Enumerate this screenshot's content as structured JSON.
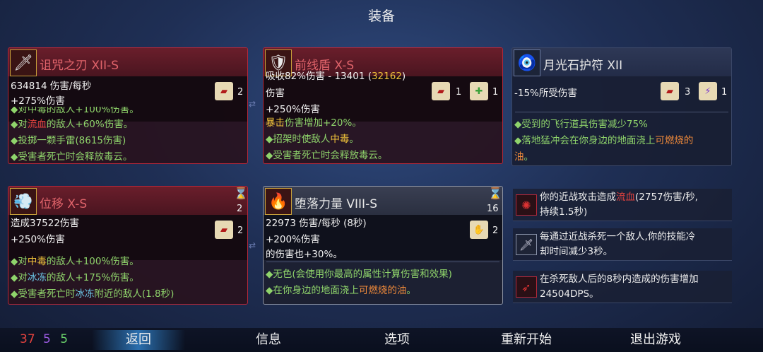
{
  "title": "装备",
  "cards": {
    "curse": {
      "name": "诅咒之刃  XII-S",
      "stat1": "634814 伤害/每秒",
      "stat2": "+275%伤害",
      "scroll_count": "2",
      "lines": [
        "◆对中毒的敌人+100%伤害。",
        "◆对流血的敌人+60%伤害。",
        "◆投掷一颗手雷(8615伤害)",
        "◆受害者死亡时会释放毒云。"
      ]
    },
    "shield": {
      "name": "前线盾  X-S",
      "stat1a": "吸收82%伤害 - 13401 (",
      "stat1b": "32162",
      "stat1c": ")",
      "stat2": "伤害",
      "stat3": "+250%伤害",
      "scroll1_count": "1",
      "scroll2_count": "1",
      "lines": [
        "◆暴击伤害增加+20%。",
        "◆招架时使敌人中毒。",
        "◆受害者死亡时会释放毒云。"
      ]
    },
    "amulet": {
      "name": "月光石护符  XII",
      "stat1": "-15%所受伤害",
      "scroll1_count": "3",
      "scroll2_count": "1",
      "lines": [
        "◆受到的飞行道具伤害减少75%",
        "◆落地猛冲会在你身边的地面浇上可燃烧的",
        "油。"
      ]
    },
    "dash": {
      "name": "位移  X-S",
      "stat1": "造成37522伤害",
      "stat2": "+250%伤害",
      "timer": "2",
      "scroll_count": "2",
      "lines": [
        "◆对中毒的敌人+100%伤害。",
        "◆对冰冻的敌人+175%伤害。",
        "◆受害者死亡时冰冻附近的敌人(1.8秒)"
      ]
    },
    "fall": {
      "name": "堕落力量  VIII-S",
      "stat1": "22973 伤害/每秒 (8秒)",
      "stat2": "+200%伤害",
      "stat3": "的伤害也+30%。",
      "timer": "16",
      "scroll_count": "2",
      "lines": [
        "◆无色(会使用你最高的属性计算伤害和效果)",
        "◆在你身边的地面浇上可燃烧的油。"
      ]
    }
  },
  "perks": [
    {
      "line1": "你的近战攻击造成流血(2757伤害/秒,",
      "line2": "持续1.5秒)"
    },
    {
      "line1": "每通过近战杀死一个敌人,你的技能冷",
      "line2": "却时间减少3秒。"
    },
    {
      "line1": "在杀死敌人后的8秒内造成的伤害增加",
      "line2": "24504DPS。"
    }
  ],
  "footer": {
    "stat_red": "37",
    "stat_purple": "5",
    "stat_green": "5",
    "back": "返回",
    "info": "信息",
    "options": "选项",
    "restart": "重新开始",
    "quit": "退出游戏"
  },
  "colors": {
    "brutality": "#e2423e",
    "tactics": "#9a5ae0",
    "survival": "#6ad16a"
  }
}
